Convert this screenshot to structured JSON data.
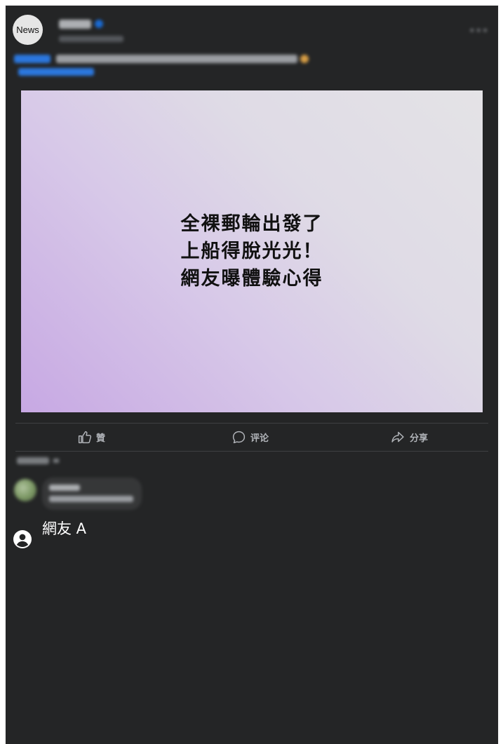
{
  "post": {
    "avatar_text": "News",
    "headline_lines": [
      "全裸郵輪出發了",
      "上船得脫光光！",
      "網友曝體驗心得"
    ]
  },
  "actions": {
    "like_label": "贊",
    "comment_label": "评论",
    "share_label": "分享"
  },
  "comment_user": {
    "name": "網友 A"
  },
  "colors": {
    "background": "#242526",
    "accent": "#1877f2",
    "action_text": "#b0b3b8"
  },
  "icons": [
    "more-icon",
    "like-icon",
    "comment-icon",
    "share-icon",
    "user-icon"
  ]
}
